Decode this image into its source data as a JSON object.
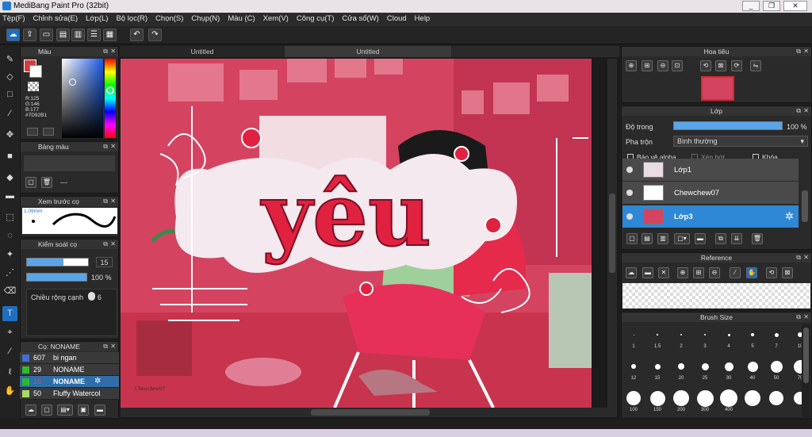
{
  "window": {
    "title": "MediBang Paint Pro (32bit)",
    "minimize": "_",
    "restore": "❐",
    "close": "✕"
  },
  "menu": [
    "Tệp(F)",
    "Chỉnh sửa(E)",
    "Lớp(L)",
    "Bộ lọc(R)",
    "Chọn(S)",
    "Chụp(N)",
    "Màu (C)",
    "Xem(V)",
    "Công cụ(T)",
    "Cửa sổ(W)",
    "Cloud",
    "Help"
  ],
  "doc_tabs": [
    "Untitled",
    "Untitled"
  ],
  "color_panel": {
    "title": "Màu",
    "r": "R:125",
    "g": "G:146",
    "b": "B:177",
    "hex": "#7D92B1"
  },
  "palette_panel": {
    "title": "Bảng màu",
    "more": "---"
  },
  "preview_panel": {
    "title": "Xem trước cọ",
    "size": "1.09mm"
  },
  "brush_control": {
    "title": "Kiểm soát cọ",
    "size_value": "15",
    "opacity_value": "100 %",
    "width_label": "Chiều rộng cạnh",
    "width_value": "6"
  },
  "brush_panel": {
    "title": "Cọ: NONAME",
    "items": [
      {
        "size": "607",
        "name": "bi ngan",
        "color": "#3d6fd1"
      },
      {
        "size": "29",
        "name": "NONAME",
        "color": "#2fb92f"
      },
      {
        "size": "15",
        "name": "NONAME",
        "color": "#2fb92f"
      },
      {
        "size": "50",
        "name": "Fluffy Watercol",
        "color": "#a8d86a"
      }
    ]
  },
  "navigator": {
    "title": "Hoa tiêu"
  },
  "layer_panel": {
    "title": "Lớp",
    "opacity_label": "Độ trong",
    "opacity_value": "100 %",
    "opacity_fraction": 1.0,
    "blend_label": "Pha trộn",
    "blend_value": "Bình thường",
    "protect_alpha": "Bảo vệ alpha",
    "clipping": "Xén bớt",
    "lock": "Khóa",
    "layers": [
      {
        "name": "Lớp1",
        "selected": false
      },
      {
        "name": "Chewchew07",
        "selected": false
      },
      {
        "name": "Lớp3",
        "selected": true
      }
    ]
  },
  "reference_panel": {
    "title": "Reference"
  },
  "brush_size_panel": {
    "title": "Brush Size",
    "sizes": [
      "1",
      "1.5",
      "2",
      "3",
      "4",
      "5",
      "7",
      "10",
      "12",
      "15",
      "20",
      "25",
      "30",
      "40",
      "50",
      "70",
      "100",
      "150",
      "200",
      "300",
      "400",
      "",
      "",
      ""
    ]
  },
  "canvas": {
    "artwork_text": "yêu",
    "signature": "Chewchew07"
  }
}
